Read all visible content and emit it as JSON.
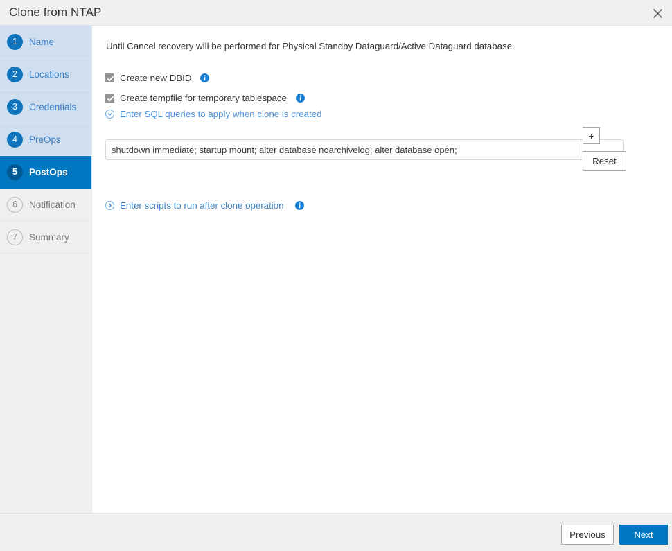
{
  "header": {
    "title": "Clone from NTAP",
    "close_icon": "close-icon"
  },
  "sidebar": {
    "steps": [
      {
        "number": "1",
        "label": "Name",
        "state": "done"
      },
      {
        "number": "2",
        "label": "Locations",
        "state": "done"
      },
      {
        "number": "3",
        "label": "Credentials",
        "state": "done"
      },
      {
        "number": "4",
        "label": "PreOps",
        "state": "done"
      },
      {
        "number": "5",
        "label": "PostOps",
        "state": "active"
      },
      {
        "number": "6",
        "label": "Notification",
        "state": "pending"
      },
      {
        "number": "7",
        "label": "Summary",
        "state": "pending"
      }
    ]
  },
  "main": {
    "intro": "Until Cancel recovery will be performed for Physical Standby Dataguard/Active Dataguard database.",
    "checkboxes": [
      {
        "label": "Create new DBID",
        "checked": true,
        "info_icon": "info-icon"
      },
      {
        "label": "Create tempfile for temporary tablespace",
        "checked": true,
        "info_icon": "info-icon"
      }
    ],
    "sql_section": {
      "expander_label": "Enter SQL queries to apply when clone is created",
      "expander_icon": "chevron-down-circle-icon",
      "expanded": true,
      "query_value": "shutdown immediate; startup mount; alter database noarchivelog; alter database open;",
      "query_placeholder": "",
      "secondary_value": "",
      "secondary_placeholder": "",
      "add_label": "+",
      "reset_label": "Reset"
    },
    "scripts_section": {
      "expander_label": "Enter scripts to run after clone operation",
      "expander_icon": "chevron-right-circle-icon",
      "expanded": false,
      "info_icon": "info-icon"
    }
  },
  "footer": {
    "previous_label": "Previous",
    "next_label": "Next"
  },
  "colors": {
    "accent": "#0077c0",
    "accent_dark": "#005a91",
    "step_done_bg": "#cfdff0",
    "link": "#4a90d9",
    "header_bg": "#f0f0f0"
  }
}
